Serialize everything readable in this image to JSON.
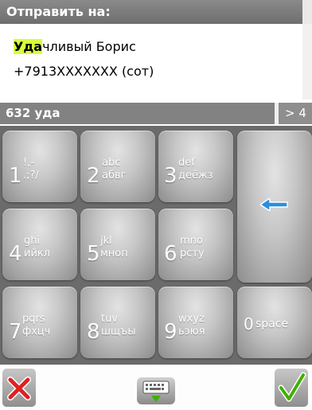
{
  "header": {
    "title": "Отправить на:"
  },
  "contact": {
    "name_highlight": "Уда",
    "name_rest": "чливый Борис",
    "phone": "+7913XXXXXXX (сот)"
  },
  "input": {
    "query": "632 уда",
    "next_label": "> 4"
  },
  "keys": [
    {
      "digit": "1",
      "l1": "!,-",
      "l2": ".;?/"
    },
    {
      "digit": "2",
      "l1": "abc",
      "l2": "абвг"
    },
    {
      "digit": "3",
      "l1": "def",
      "l2": "деёжз"
    },
    {
      "digit": "4",
      "l1": "ghi",
      "l2": "ийкл"
    },
    {
      "digit": "5",
      "l1": "jkl",
      "l2": "мноп"
    },
    {
      "digit": "6",
      "l1": "mno",
      "l2": "рсту"
    },
    {
      "digit": "7",
      "l1": "pqrs",
      "l2": "фхцч"
    },
    {
      "digit": "8",
      "l1": "tuv",
      "l2": "шщъы"
    },
    {
      "digit": "9",
      "l1": "wxyz",
      "l2": "ьэюя"
    },
    {
      "digit": "0",
      "l1": "space",
      "l2": ""
    }
  ],
  "icons": {
    "backspace": "left-arrow-icon",
    "cancel": "close-icon",
    "keyboard": "keyboard-icon",
    "confirm": "checkmark-icon"
  },
  "colors": {
    "highlight": "#d7ff3c",
    "header": "#7a7a7a",
    "cancel": "#e02020",
    "confirm": "#3fb000",
    "backspace_arrow": "#2a8fe0"
  }
}
